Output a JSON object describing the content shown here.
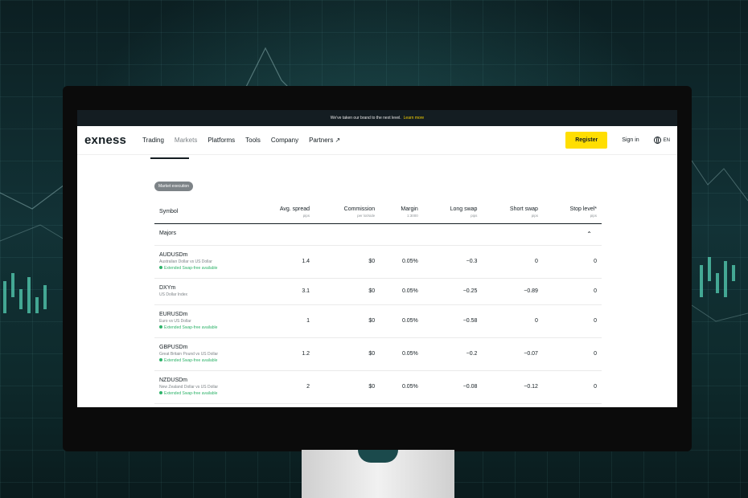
{
  "banner": {
    "text": "We've taken our brand to the next level.",
    "link": "Learn more"
  },
  "nav": {
    "logo": "exness",
    "items": [
      "Trading",
      "Markets",
      "Platforms",
      "Tools",
      "Company",
      "Partners ↗"
    ],
    "register": "Register",
    "signin": "Sign in",
    "lang": "EN"
  },
  "tag": "Market execution",
  "table": {
    "headers": [
      {
        "label": "Symbol",
        "sub": ""
      },
      {
        "label": "Avg. spread",
        "sub": "pips"
      },
      {
        "label": "Commission",
        "sub": "per lot/side"
      },
      {
        "label": "Margin",
        "sub": "1:3000"
      },
      {
        "label": "Long swap",
        "sub": "pips"
      },
      {
        "label": "Short swap",
        "sub": "pips"
      },
      {
        "label": "Stop level*",
        "sub": "pips"
      }
    ],
    "group": "Majors",
    "rows": [
      {
        "symbol": "AUDUSDm",
        "desc": "Australian Dollar vs US Dollar",
        "swapfree": "Extended Swap-free available",
        "spread": "1.4",
        "commission": "$0",
        "margin": "0.05%",
        "long": "−0.3",
        "short": "0",
        "stop": "0"
      },
      {
        "symbol": "DXYm",
        "desc": "US Dollar Index",
        "swapfree": "",
        "spread": "3.1",
        "commission": "$0",
        "margin": "0.05%",
        "long": "−0.25",
        "short": "−0.89",
        "stop": "0"
      },
      {
        "symbol": "EURUSDm",
        "desc": "Euro vs US Dollar",
        "swapfree": "Extended Swap-free available",
        "spread": "1",
        "commission": "$0",
        "margin": "0.05%",
        "long": "−0.58",
        "short": "0",
        "stop": "0"
      },
      {
        "symbol": "GBPUSDm",
        "desc": "Great Britain Pound vs US Dollar",
        "swapfree": "Extended Swap-free available",
        "spread": "1.2",
        "commission": "$0",
        "margin": "0.05%",
        "long": "−0.2",
        "short": "−0.07",
        "stop": "0"
      },
      {
        "symbol": "NZDUSDm",
        "desc": "New Zealand Dollar vs US Dollar",
        "swapfree": "Extended Swap-free available",
        "spread": "2",
        "commission": "$0",
        "margin": "0.05%",
        "long": "−0.08",
        "short": "−0.12",
        "stop": "0"
      }
    ]
  },
  "colors": {
    "accent": "#ffde02",
    "dark": "#141d22",
    "green": "#2fb36a"
  }
}
